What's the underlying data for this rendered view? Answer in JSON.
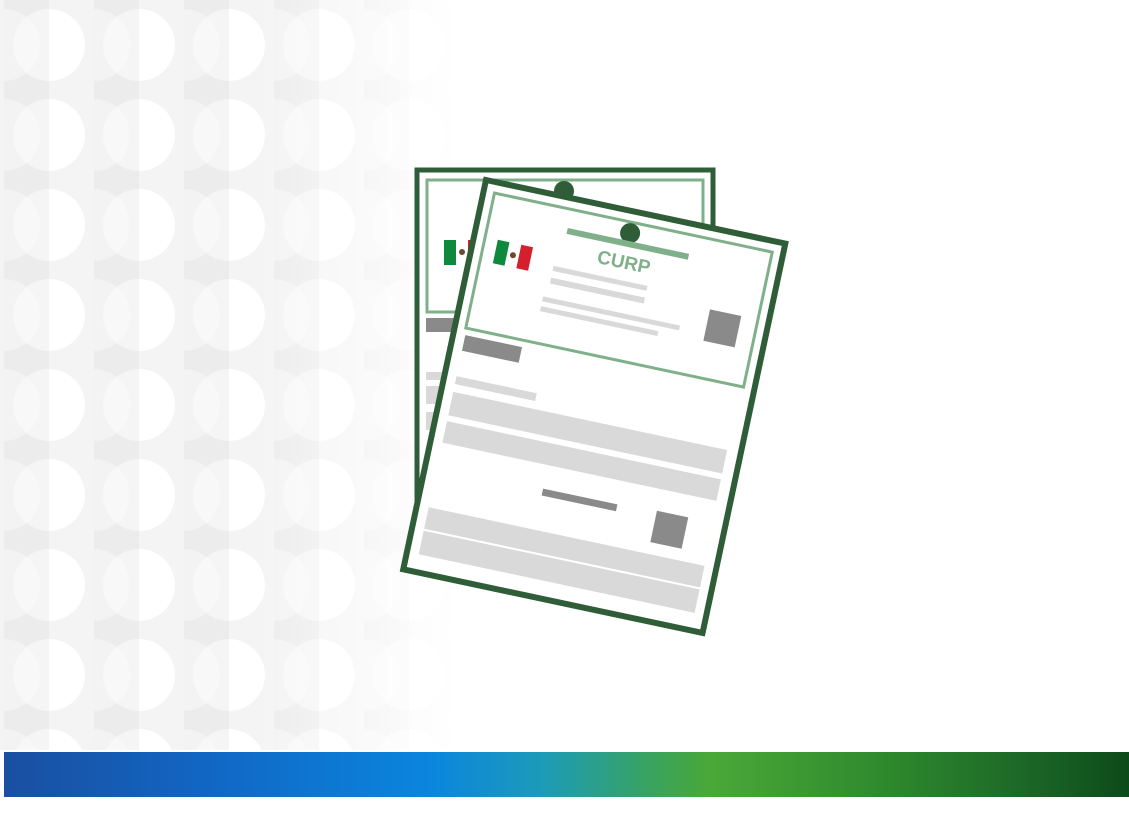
{
  "document": {
    "title": "CURP"
  },
  "colors": {
    "frame_green": "#2e5d38",
    "light_green": "#7fb08a",
    "flag_green": "#0f8a3c",
    "flag_red": "#d4202c",
    "gray_block": "#8a8a8a",
    "light_gray": "#d9d9d9",
    "bar_start": "#1a4fa0",
    "bar_end": "#0d4a1a"
  },
  "icons": [
    "mexico-flag-icon",
    "curp-document-icon"
  ]
}
